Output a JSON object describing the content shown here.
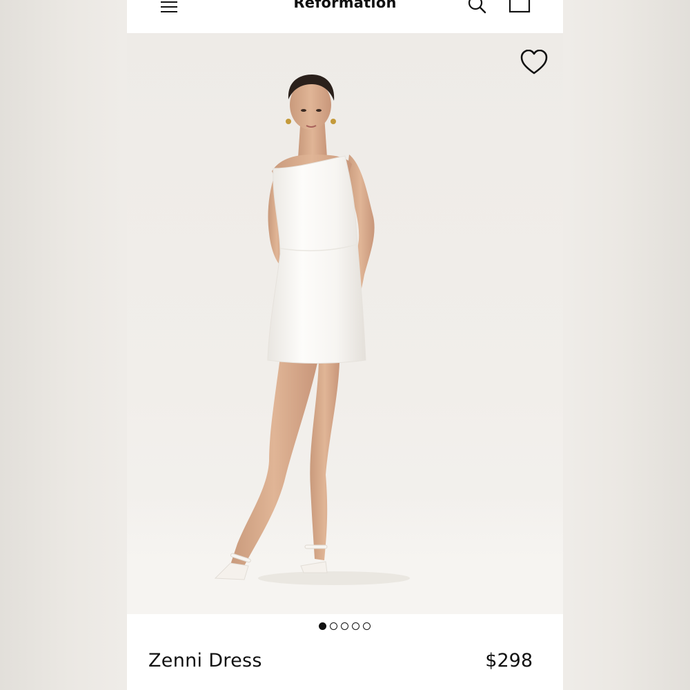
{
  "header": {
    "brand": "Reformation",
    "menu_icon": "hamburger-menu-icon",
    "search_icon": "search-icon",
    "bag_icon": "shopping-bag-icon"
  },
  "gallery": {
    "favorite_icon": "heart-icon",
    "image_subject": "model-in-white-mini-dress",
    "image_count": 5,
    "active_index": 0
  },
  "product": {
    "name": "Zenni Dress",
    "price": "$298"
  }
}
